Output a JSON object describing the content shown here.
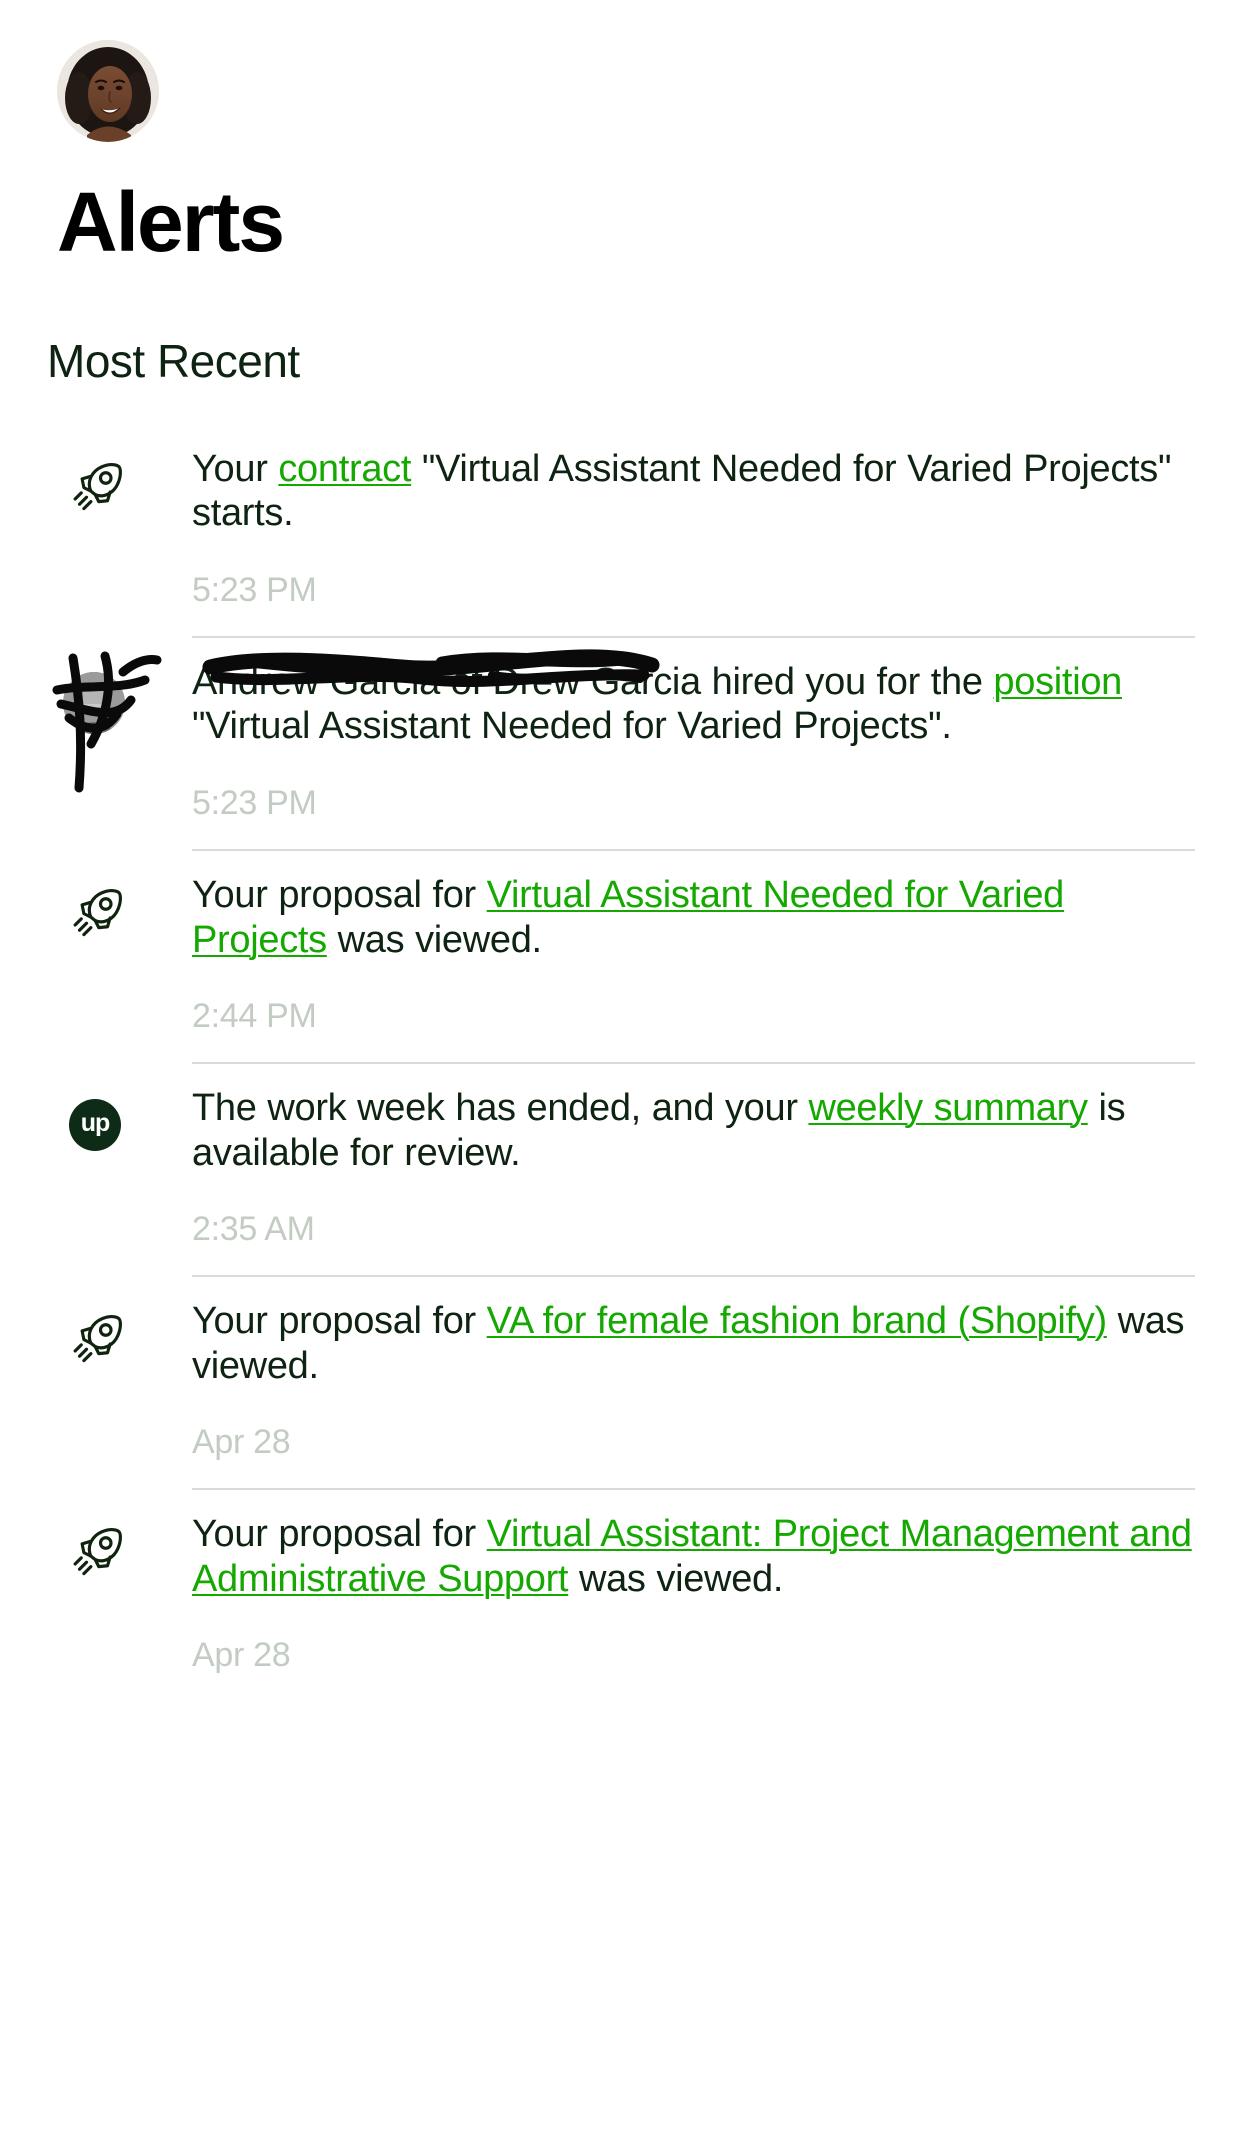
{
  "header": {
    "avatar_alt": "user-profile-photo",
    "title": "Alerts"
  },
  "section": {
    "title": "Most Recent"
  },
  "colors": {
    "link_green": "#14a800",
    "text_dark": "#0f2312",
    "time_gray": "#c3ccc3",
    "divider": "#d6dcd6",
    "upwork_logo_bg": "#0d2b16",
    "title_black": "#000000"
  },
  "alerts": [
    {
      "icon": "rocket-icon",
      "segments": [
        {
          "text": "Your ",
          "link": false
        },
        {
          "text": "contract",
          "link": true
        },
        {
          "text": " \"Virtual Assistant Needed for Varied Projects\" starts.",
          "link": false
        }
      ],
      "time": "5:23 PM",
      "redacted": false
    },
    {
      "icon": "person-avatar-icon",
      "segments": [
        {
          "text": "Andrew Garcia of Drew Garcia",
          "link": false,
          "redacted": true
        },
        {
          "text": " hired you for the ",
          "link": false
        },
        {
          "text": "position",
          "link": true
        },
        {
          "text": " \"Virtual Assistant Needed for Varied Projects\".",
          "link": false
        }
      ],
      "time": "5:23 PM",
      "redacted": true
    },
    {
      "icon": "rocket-icon",
      "segments": [
        {
          "text": "Your proposal for ",
          "link": false
        },
        {
          "text": "Virtual Assistant Needed for Varied Projects",
          "link": true
        },
        {
          "text": " was viewed.",
          "link": false
        }
      ],
      "time": "2:44 PM",
      "redacted": false
    },
    {
      "icon": "upwork-logo-icon",
      "icon_label": "up",
      "segments": [
        {
          "text": "The work week has ended, and your ",
          "link": false
        },
        {
          "text": "weekly summary",
          "link": true
        },
        {
          "text": " is available for review.",
          "link": false
        }
      ],
      "time": "2:35 AM",
      "redacted": false
    },
    {
      "icon": "rocket-icon",
      "segments": [
        {
          "text": "Your proposal for ",
          "link": false
        },
        {
          "text": "VA for female fashion brand (Shopify)",
          "link": true
        },
        {
          "text": " was viewed.",
          "link": false
        }
      ],
      "time": "Apr 28",
      "redacted": false
    },
    {
      "icon": "rocket-icon",
      "segments": [
        {
          "text": "Your proposal for ",
          "link": false
        },
        {
          "text": "Virtual Assistant: Project Management and Administrative Support",
          "link": true
        },
        {
          "text": " was viewed.",
          "link": false
        }
      ],
      "time": "Apr 28",
      "redacted": false
    }
  ]
}
